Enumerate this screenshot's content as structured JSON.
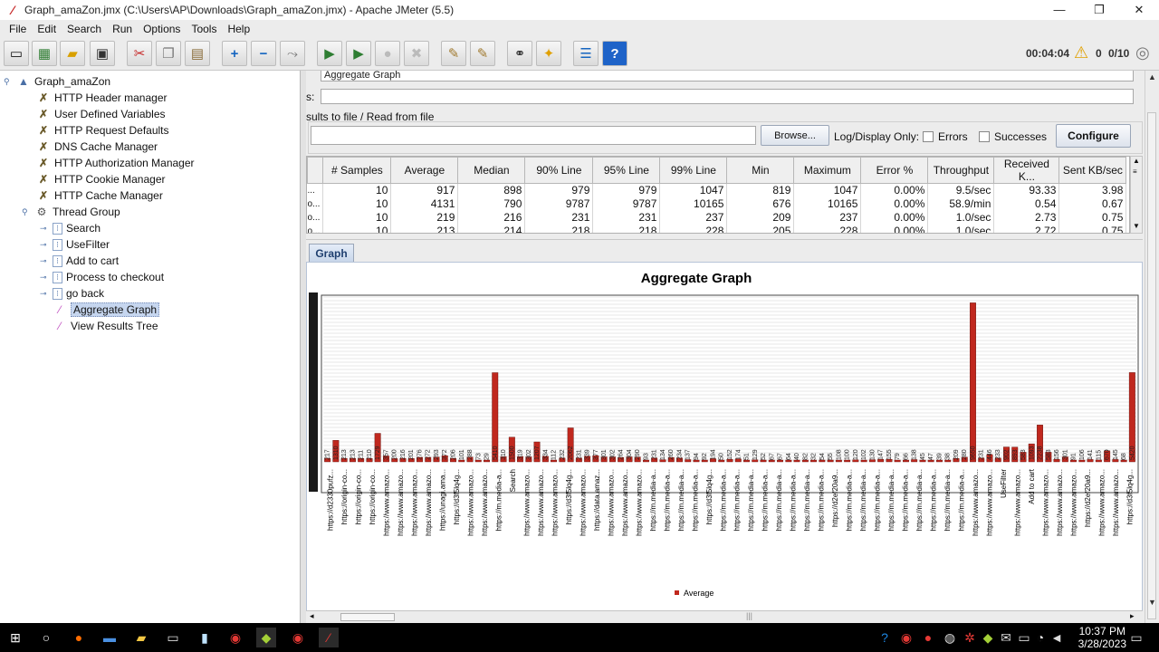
{
  "window": {
    "title": "Graph_amaZon.jmx (C:\\Users\\AP\\Downloads\\Graph_amaZon.jmx) - Apache JMeter (5.5)",
    "minimize": "—",
    "maximize": "❐",
    "close": "✕"
  },
  "menu": [
    "File",
    "Edit",
    "Search",
    "Run",
    "Options",
    "Tools",
    "Help"
  ],
  "toolbar": {
    "icons": [
      "new-icon",
      "templates-icon",
      "open-icon",
      "save-icon",
      "cut-icon",
      "copy-icon",
      "paste-icon",
      "expand-icon",
      "collapse-icon",
      "toggle-icon",
      "start-icon",
      "start-no-pause-icon",
      "stop-icon",
      "shutdown-icon",
      "clear-icon",
      "clear-all-icon",
      "search-icon",
      "reset-search-icon",
      "function-helper-icon",
      "help-icon"
    ],
    "elapsed": "00:04:04",
    "warnings": "0",
    "threads": "0/10"
  },
  "tree": {
    "root": "Graph_amaZon",
    "items": [
      {
        "label": "HTTP Header manager",
        "kind": "config"
      },
      {
        "label": "User Defined Variables",
        "kind": "config"
      },
      {
        "label": "HTTP Request Defaults",
        "kind": "config"
      },
      {
        "label": "DNS Cache Manager",
        "kind": "config"
      },
      {
        "label": "HTTP Authorization Manager",
        "kind": "config"
      },
      {
        "label": "HTTP Cookie Manager",
        "kind": "config"
      },
      {
        "label": "HTTP Cache Manager",
        "kind": "config"
      },
      {
        "label": "Thread Group",
        "kind": "threadgroup"
      }
    ],
    "children": [
      {
        "label": "Search",
        "kind": "controller"
      },
      {
        "label": "UseFilter",
        "kind": "controller"
      },
      {
        "label": "Add to cart",
        "kind": "controller"
      },
      {
        "label": "Process to checkout",
        "kind": "controller"
      },
      {
        "label": "go back",
        "kind": "controller"
      },
      {
        "label": "Aggregate Graph",
        "kind": "listener"
      },
      {
        "label": "View Results Tree",
        "kind": "listener"
      }
    ]
  },
  "panel": {
    "name_value": "Aggregate Graph",
    "comments_label": "s:",
    "write_results_title": "sults to file / Read from file",
    "browse": "Browse...",
    "log_display": "Log/Display Only:",
    "errors": "Errors",
    "successes": "Successes",
    "configure": "Configure"
  },
  "table": {
    "columns": [
      "# Samples",
      "Average",
      "Median",
      "90% Line",
      "95% Line",
      "99% Line",
      "Min",
      "Maximum",
      "Error %",
      "Throughput",
      "Received K...",
      "Sent KB/sec"
    ],
    "label_cells": [
      "...",
      "o...",
      "o...",
      "o...",
      "o..."
    ],
    "rows": [
      [
        "10",
        "917",
        "898",
        "979",
        "979",
        "1047",
        "819",
        "1047",
        "0.00%",
        "9.5/sec",
        "93.33",
        "3.98"
      ],
      [
        "10",
        "4131",
        "790",
        "9787",
        "9787",
        "10165",
        "676",
        "10165",
        "0.00%",
        "58.9/min",
        "0.54",
        "0.67"
      ],
      [
        "10",
        "219",
        "216",
        "231",
        "231",
        "237",
        "209",
        "237",
        "0.00%",
        "1.0/sec",
        "2.73",
        "0.75"
      ],
      [
        "10",
        "213",
        "214",
        "218",
        "218",
        "228",
        "205",
        "228",
        "0.00%",
        "1.0/sec",
        "2.72",
        "0.75"
      ],
      [
        "10",
        "213",
        "214",
        "221",
        "221",
        "223",
        "203",
        "223",
        "0.00%",
        "1.0/sec",
        "2.74",
        "0.75"
      ]
    ]
  },
  "tab_label": "Graph",
  "chart_data": {
    "type": "bar",
    "title": "Aggregate Graph",
    "legend": [
      "Average"
    ],
    "legend_placement": "bottom",
    "color": "#c0281e",
    "grid": true,
    "ylim": [
      0,
      10000
    ],
    "series": [
      {
        "name": "Average",
        "values": [
          217,
          1310,
          213,
          213,
          211,
          210,
          1729,
          357,
          200,
          216,
          201,
          276,
          272,
          293,
          372,
          206,
          101,
          288,
          73,
          29,
          5410,
          310,
          1500,
          319,
          302,
          1207,
          334,
          112,
          232,
          2062,
          231,
          339,
          377,
          301,
          302,
          264,
          304,
          290,
          93,
          231,
          134,
          260,
          234,
          137,
          94,
          92,
          194,
          50,
          152,
          174,
          51,
          129,
          52,
          67,
          67,
          64,
          40,
          82,
          32,
          54,
          55,
          108,
          100,
          120,
          102,
          130,
          147,
          155,
          79,
          66,
          138,
          45,
          47,
          39,
          38,
          209,
          280,
          9650,
          231,
          446,
          233,
          902,
          893,
          583,
          1093,
          2238,
          583,
          156,
          301,
          91,
          106,
          141,
          115,
          670,
          145,
          68,
          5420
        ]
      }
    ],
    "categories": [
      "https://d2330pufz...",
      "https://origin-co...",
      "https://origin-co...",
      "https://origin-co...",
      "https://www.amazo...",
      "https://www.amazo...",
      "https://www.amazo...",
      "https://www.amazo...",
      "https://unagi.ama...",
      "https://d3f5lq4g...",
      "https://www.amazo...",
      "https://www.amazo...",
      "https://m.media-a...",
      "Search",
      "https://www.amazo...",
      "https://www.amazo...",
      "https://www.amazo...",
      "https://d3f5lq4g...",
      "https://www.amazo...",
      "https://data.amaz...",
      "https://www.amazo...",
      "https://www.amazo...",
      "https://www.amazo...",
      "https://m.media-a...",
      "https://m.media-a...",
      "https://m.media-a...",
      "https://m.media-a...",
      "https://d3f5lq4g...",
      "https://m.media-a...",
      "https://m.media-a...",
      "https://m.media-a...",
      "https://m.media-a...",
      "https://m.media-a...",
      "https://m.media-a...",
      "https://m.media-a...",
      "https://m.media-a...",
      "https://d2ef20a9...",
      "https://m.media-a...",
      "https://m.media-a...",
      "https://m.media-a...",
      "https://m.media-a...",
      "https://m.media-a...",
      "https://m.media-a...",
      "https://m.media-a...",
      "https://m.media-a...",
      "https://m.media-a...",
      "https://www.amazo...",
      "https://www.amazo...",
      "UseFilter",
      "https://www.amazo...",
      "Add to cart",
      "https://www.amazo...",
      "https://www.amazo...",
      "https://www.amazo...",
      "https://d2ef20a9...",
      "https://www.amazo...",
      "https://www.amazo...",
      "https://d3f5lq4g..."
    ]
  },
  "taskbar": {
    "time": "10:37 PM",
    "date": "3/28/2023"
  }
}
